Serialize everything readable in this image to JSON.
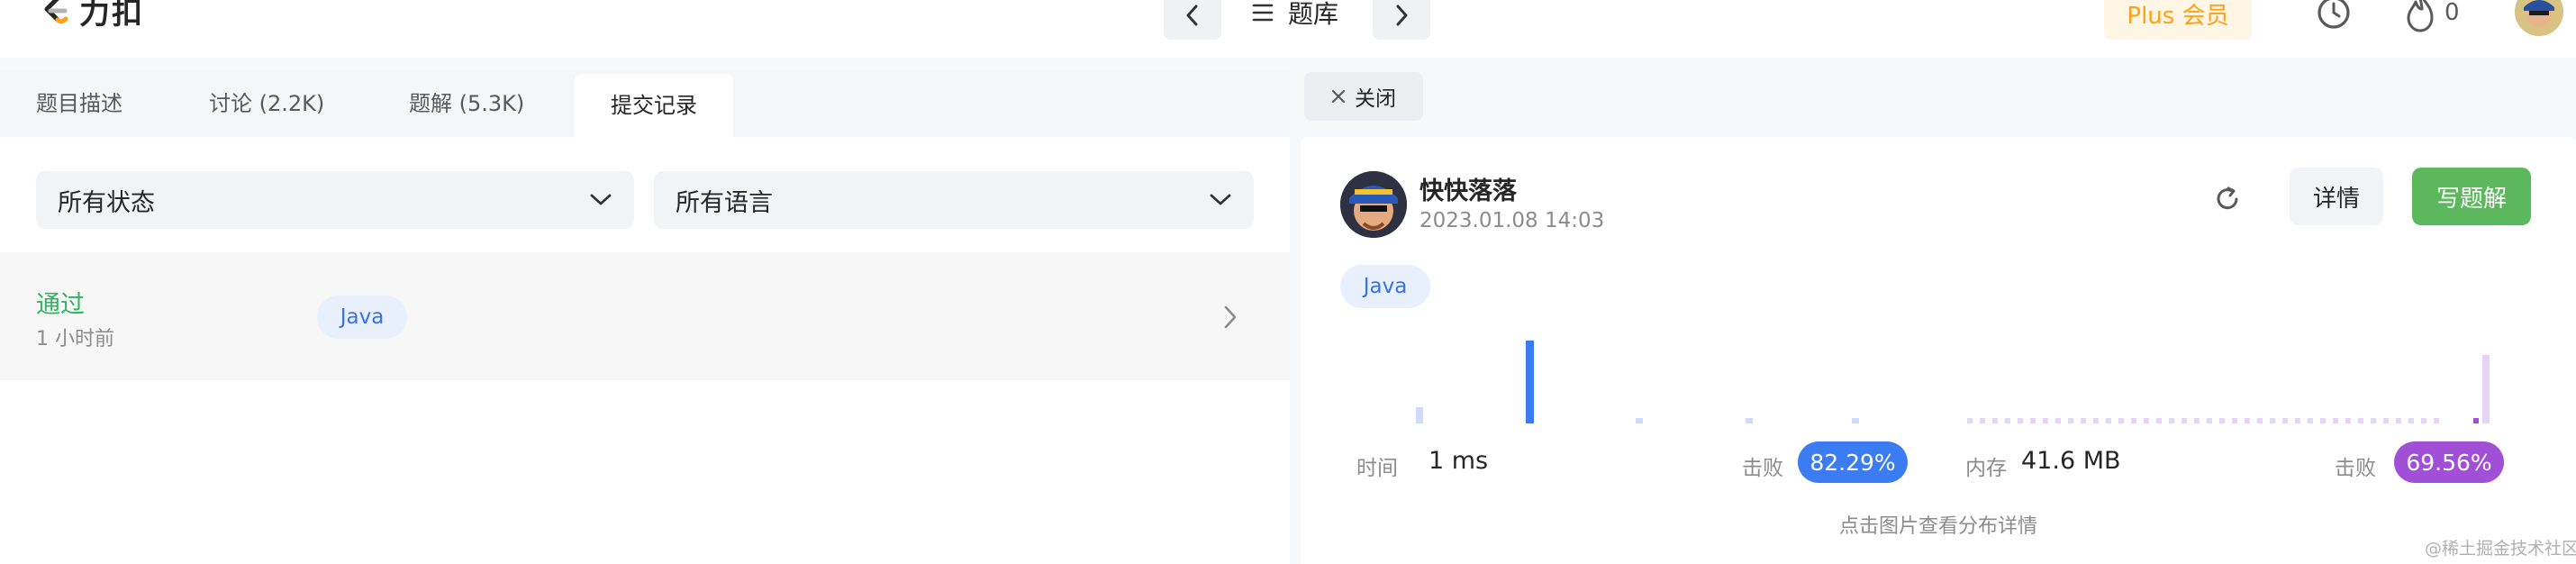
{
  "topbar": {
    "logo_text": "力扣",
    "problem_list_label": "题库",
    "plus_label": "Plus 会员",
    "streak_count": "0"
  },
  "tabs": [
    {
      "label": "题目描述"
    },
    {
      "label": "讨论 (2.2K)"
    },
    {
      "label": "题解 (5.3K)"
    },
    {
      "label": "提交记录"
    }
  ],
  "filters": {
    "status": "所有状态",
    "language": "所有语言"
  },
  "submission": {
    "status": "通过",
    "time_ago": "1 小时前",
    "language": "Java"
  },
  "detail": {
    "close_label": "关闭",
    "user_name": "快快落落",
    "date": "2023.01.08 14:03",
    "detail_button": "详情",
    "solution_button": "写题解",
    "language": "Java",
    "runtime": {
      "label": "时间",
      "value": "1 ms",
      "beat_label": "击败",
      "beat_value": "82.29%",
      "beat_color": "#3b7cf2",
      "chart_color": "#3b7cf2",
      "chart_light": "#cddcfb"
    },
    "memory": {
      "label": "内存",
      "value": "41.6 MB",
      "beat_label": "击败",
      "beat_value": "69.56%",
      "beat_color": "#a04fd6",
      "chart_color": "#a04fd6",
      "chart_light": "#e6d3f5"
    },
    "hint": "点击图片查看分布详情"
  },
  "watermark": "@稀土掘金技术社区"
}
